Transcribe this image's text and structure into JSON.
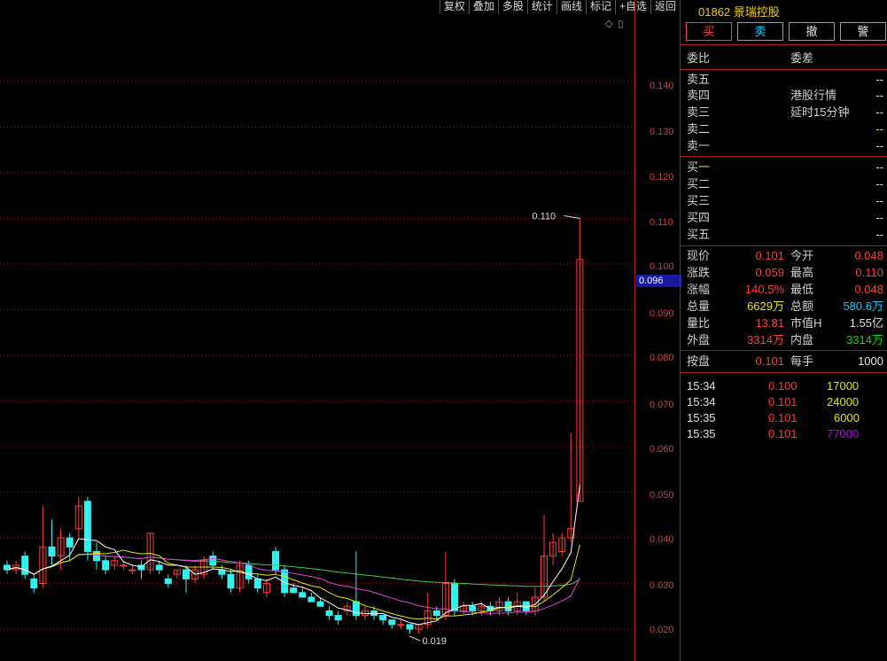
{
  "toolbar": [
    "复权",
    "叠加",
    "多股",
    "统计",
    "画线",
    "标记",
    "+自选",
    "返回"
  ],
  "chart": {
    "axis_labels": [
      "0.140",
      "0.130",
      "0.120",
      "0.110",
      "0.100",
      "0.090",
      "0.080",
      "0.070",
      "0.060",
      "0.050",
      "0.040",
      "0.030",
      "0.020"
    ],
    "current_price": "0.096",
    "high_annotation": "0.110",
    "low_annotation": "0.019",
    "colors": {
      "up": "#ff3b3b",
      "down": "#33f0f0",
      "ma5": "#ffffff",
      "ma10": "#e6e600",
      "ma20": "#e040e0",
      "ma60": "#40d040",
      "grid": "#8a1a1a"
    }
  },
  "stock": {
    "code": "01862",
    "name": "景瑞控股"
  },
  "trade_buttons": [
    "买",
    "卖",
    "撤",
    "警"
  ],
  "order_book": {
    "header": {
      "left": "委比",
      "right": "委差"
    },
    "asks": [
      {
        "label": "卖五",
        "value": "--"
      },
      {
        "label": "卖四",
        "value": "--"
      },
      {
        "label": "卖三",
        "value": "--"
      },
      {
        "label": "卖二",
        "value": "--"
      },
      {
        "label": "卖一",
        "value": "--"
      }
    ],
    "notes": [
      "港股行情",
      "延时15分钟"
    ],
    "bids": [
      {
        "label": "买一",
        "value": "--"
      },
      {
        "label": "买二",
        "value": "--"
      },
      {
        "label": "买三",
        "value": "--"
      },
      {
        "label": "买四",
        "value": "--"
      },
      {
        "label": "买五",
        "value": "--"
      }
    ]
  },
  "quote": [
    {
      "l1": "现价",
      "v1": "0.101",
      "c1": "red",
      "l2": "今开",
      "v2": "0.048",
      "c2": "red"
    },
    {
      "l1": "涨跌",
      "v1": "0.059",
      "c1": "red",
      "l2": "最高",
      "v2": "0.110",
      "c2": "red"
    },
    {
      "l1": "涨幅",
      "v1": "140.5%",
      "c1": "red",
      "l2": "最低",
      "v2": "0.048",
      "c2": "red"
    },
    {
      "l1": "总量",
      "v1": "6629万",
      "c1": "yellow",
      "l2": "总额",
      "v2": "580.6万",
      "c2": "cyan"
    },
    {
      "l1": "量比",
      "v1": "13.81",
      "c1": "red",
      "l2": "市值H",
      "v2": "1.55亿",
      "c2": "white"
    },
    {
      "l1": "外盘",
      "v1": "3314万",
      "c1": "red",
      "l2": "内盘",
      "v2": "3314万",
      "c2": "green"
    }
  ],
  "auction": {
    "l1": "按盘",
    "v1": "0.101",
    "l2": "每手",
    "v2": "1000"
  },
  "ticks": [
    {
      "time": "15:34",
      "price": "0.100",
      "vol": "17000",
      "vol_color": "yellow"
    },
    {
      "time": "15:34",
      "price": "0.101",
      "vol": "24000",
      "vol_color": "yellow"
    },
    {
      "time": "15:35",
      "price": "0.101",
      "vol": "6000",
      "vol_color": "yellow"
    },
    {
      "time": "15:35",
      "price": "0.101",
      "vol": "77000",
      "vol_color": "magenta"
    }
  ]
}
